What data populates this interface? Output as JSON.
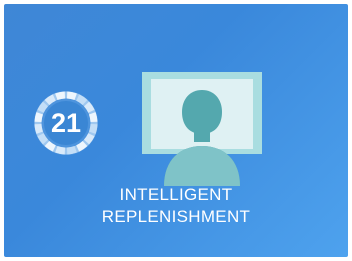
{
  "tile": {
    "badge_count": "21",
    "title_line1": "INTELLIGENT",
    "title_line2": "REPLENISHMENT",
    "icon": "user-monitor-icon"
  },
  "colors": {
    "tile_background": "#3a88db",
    "monitor_frame": "#a9dde0",
    "monitor_screen": "#dff1f3",
    "person": "#54a8ae",
    "text": "#ffffff"
  }
}
